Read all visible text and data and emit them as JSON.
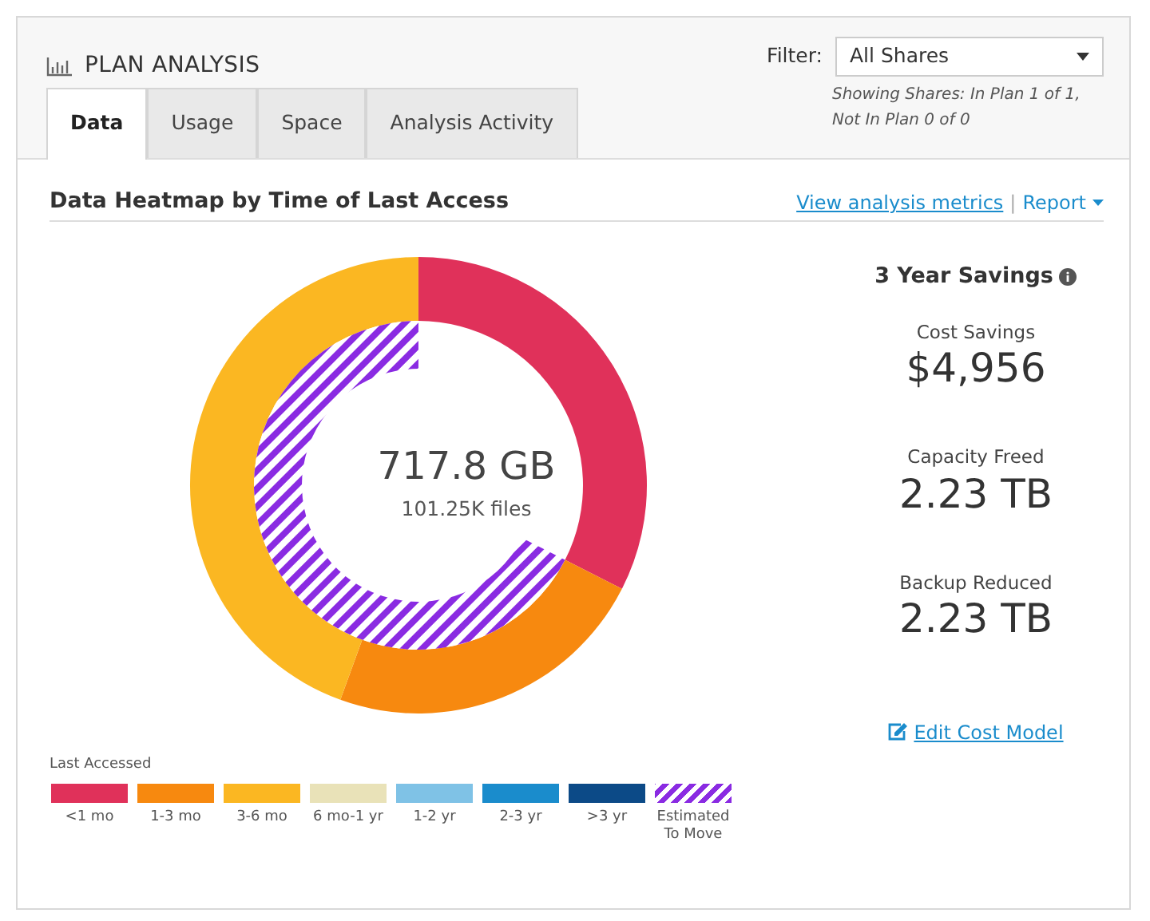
{
  "header": {
    "title": "PLAN ANALYSIS"
  },
  "filter": {
    "label": "Filter:",
    "value": "All Shares",
    "note": "Showing Shares: In Plan 1 of 1, Not In Plan 0 of 0"
  },
  "tabs": [
    {
      "label": "Data",
      "selected": true
    },
    {
      "label": "Usage",
      "selected": false
    },
    {
      "label": "Space",
      "selected": false
    },
    {
      "label": "Analysis Activity",
      "selected": false
    }
  ],
  "section": {
    "title": "Data Heatmap by Time of Last Access",
    "links": [
      "View analysis metrics",
      "Report"
    ],
    "separator": "|"
  },
  "donut": {
    "total": "717.8 GB",
    "files": "101.25K files"
  },
  "savings": {
    "title": "3 Year Savings",
    "metrics": [
      {
        "label": "Cost Savings",
        "value": "$4,956"
      },
      {
        "label": "Capacity Freed",
        "value": "2.23 TB"
      },
      {
        "label": "Backup Reduced",
        "value": "2.23 TB"
      }
    ],
    "edit_link": "Edit Cost Model"
  },
  "legend": {
    "title": "Last Accessed",
    "items": [
      {
        "label": "<1 mo",
        "color": "#e0315a",
        "kind": "solid"
      },
      {
        "label": "1-3 mo",
        "color": "#f7890f",
        "kind": "solid"
      },
      {
        "label": "3-6 mo",
        "color": "#fbb722",
        "kind": "solid"
      },
      {
        "label": "6 mo-1 yr",
        "color": "#e9e2b8",
        "kind": "solid"
      },
      {
        "label": "1-2 yr",
        "color": "#7fc2e6",
        "kind": "solid"
      },
      {
        "label": "2-3 yr",
        "color": "#1a8ccc",
        "kind": "solid"
      },
      {
        "label": ">3 yr",
        "color": "#0c4a87",
        "kind": "solid"
      },
      {
        "label": "Estimated To Move",
        "color": "#8a2be2",
        "kind": "striped"
      }
    ]
  }
}
